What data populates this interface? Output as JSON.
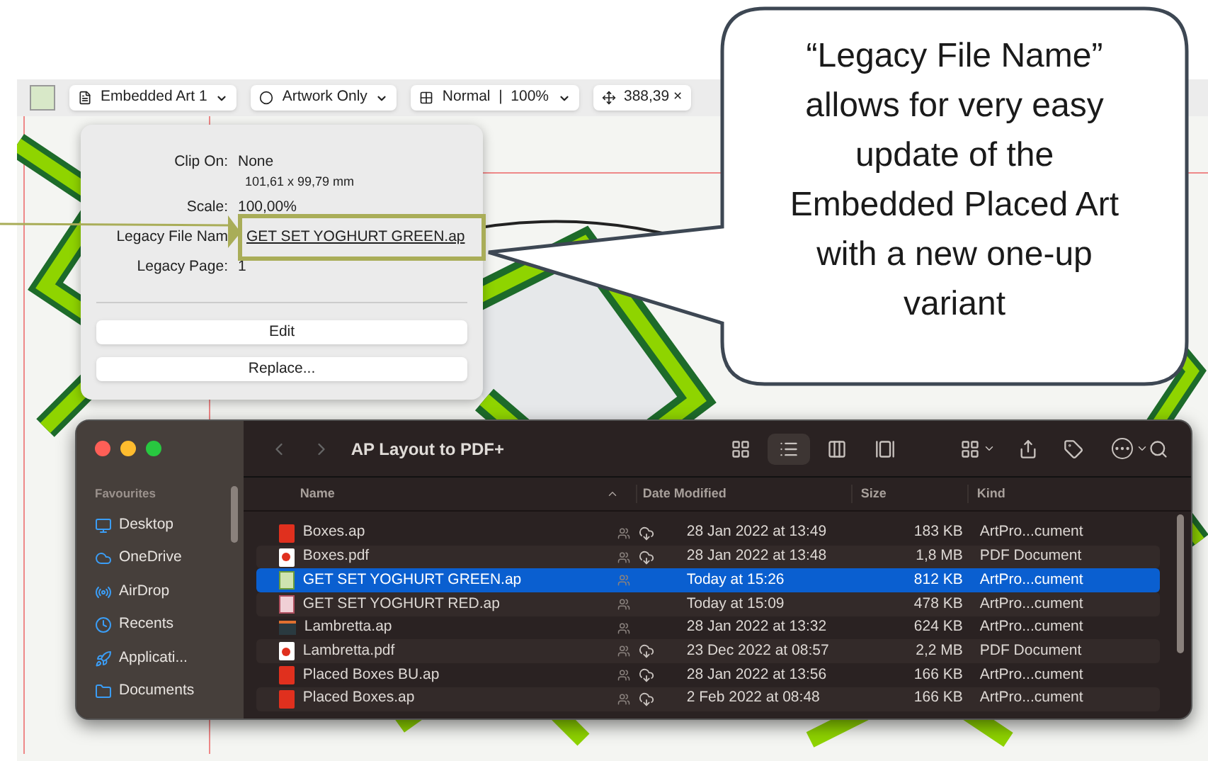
{
  "toolbar": {
    "items": [
      {
        "kind": "doc",
        "label": "Embedded Art 1"
      },
      {
        "kind": "circle",
        "label": "Artwork Only"
      },
      {
        "kind": "grid",
        "label": "Normal  |  100%"
      },
      {
        "kind": "move",
        "label": "388,39 ×"
      }
    ]
  },
  "popover": {
    "rows": [
      {
        "label": "Clip On:",
        "value": "None",
        "link": false
      },
      {
        "label": "",
        "value": "101,61 x 99,79 mm",
        "link": false
      },
      {
        "label": "Scale:",
        "value": "100,00%",
        "link": false
      },
      {
        "label": "Legacy File Nam",
        "value": "GET SET YOGHURT GREEN.ap",
        "link": true
      },
      {
        "label": "Legacy Page:",
        "value": "1",
        "link": false
      }
    ],
    "buttons": [
      "Edit",
      "Replace..."
    ]
  },
  "callout": {
    "lines": [
      "“Legacy File Name”",
      "allows for very easy",
      "update of the",
      "Embedded Placed Art",
      "with a new one-up",
      "variant"
    ]
  },
  "finder": {
    "title": "AP Layout to PDF+",
    "sidebar": {
      "heading": "Favourites",
      "items": [
        {
          "kind": "desktop",
          "label": "Desktop"
        },
        {
          "kind": "cloud",
          "label": "OneDrive"
        },
        {
          "kind": "airdrop",
          "label": "AirDrop"
        },
        {
          "kind": "clock",
          "label": "Recents"
        },
        {
          "kind": "apps",
          "label": "Applicati..."
        },
        {
          "kind": "folder",
          "label": "Documents"
        }
      ]
    },
    "views": [
      {
        "kind": "icons",
        "selected": false
      },
      {
        "kind": "list",
        "selected": true
      },
      {
        "kind": "columns",
        "selected": false
      },
      {
        "kind": "gallery",
        "selected": false
      }
    ],
    "columns": [
      "Name",
      "Date Modified",
      "Size",
      "Kind"
    ],
    "rows": [
      {
        "kind": "ap",
        "name": "Boxes.ap",
        "cloud": true,
        "date": "28 Jan 2022 at 13:49",
        "size": "183 KB",
        "type": "ArtPro...cument",
        "selected": false
      },
      {
        "kind": "pdf",
        "name": "Boxes.pdf",
        "cloud": true,
        "date": "28 Jan 2022 at 13:48",
        "size": "1,8 MB",
        "type": "PDF Document",
        "selected": false
      },
      {
        "kind": "thumb-green",
        "name": "GET SET YOGHURT GREEN.ap",
        "cloud": false,
        "date": "Today at 15:26",
        "size": "812 KB",
        "type": "ArtPro...cument",
        "selected": true
      },
      {
        "kind": "thumb-red",
        "name": "GET SET YOGHURT RED.ap",
        "cloud": false,
        "date": "Today at 15:09",
        "size": "478 KB",
        "type": "ArtPro...cument",
        "selected": false
      },
      {
        "kind": "thumb-dark",
        "name": "Lambretta.ap",
        "cloud": false,
        "date": "28 Jan 2022 at 13:32",
        "size": "624 KB",
        "type": "ArtPro...cument",
        "selected": false
      },
      {
        "kind": "pdf",
        "name": "Lambretta.pdf",
        "cloud": true,
        "date": "23 Dec 2022 at 08:57",
        "size": "2,2 MB",
        "type": "PDF Document",
        "selected": false
      },
      {
        "kind": "ap",
        "name": "Placed Boxes BU.ap",
        "cloud": true,
        "date": "28 Jan 2022 at 13:56",
        "size": "166 KB",
        "type": "ArtPro...cument",
        "selected": false
      },
      {
        "kind": "ap",
        "name": "Placed Boxes.ap",
        "cloud": true,
        "date": "2 Feb 2022 at 08:48",
        "size": "166 KB",
        "type": "ArtPro...cument",
        "selected": false
      }
    ]
  }
}
